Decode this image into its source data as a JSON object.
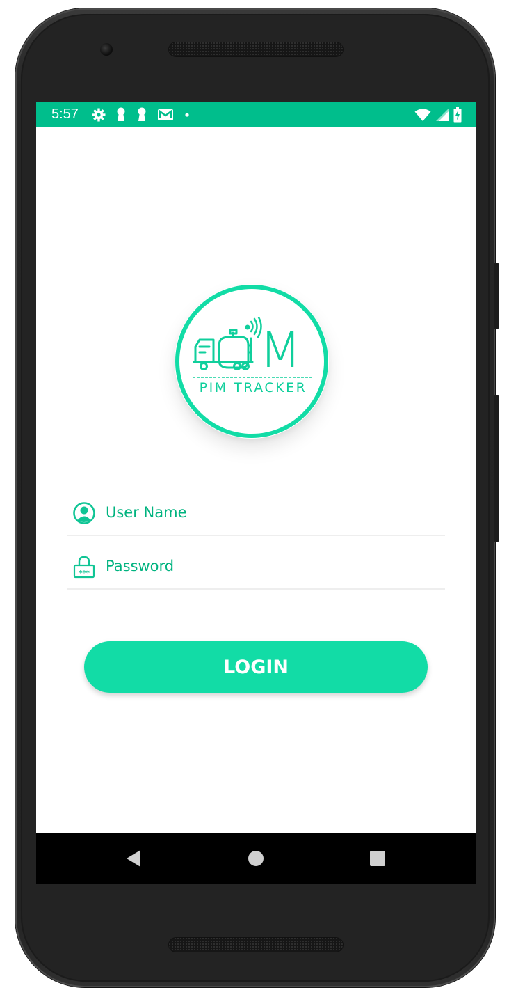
{
  "status_bar": {
    "time": "5:57",
    "background": "#00be8c",
    "left_icons": [
      "settings-icon",
      "keyhole-icon",
      "keyhole-icon",
      "gmail-icon",
      "dot-icon"
    ],
    "right_icons": [
      "wifi-icon",
      "cell-signal-icon",
      "battery-charging-icon"
    ]
  },
  "logo": {
    "letter": "M",
    "name": "PIM TRACKER",
    "color": "#10cf9c"
  },
  "form": {
    "username_placeholder": "User Name",
    "password_placeholder": "Password",
    "username_icon": "user-circle-icon",
    "password_icon": "lock-icon"
  },
  "login_button": {
    "label": "LOGIN",
    "color": "#12dca6"
  },
  "nav_bar": {
    "back": "back-icon",
    "home": "home-icon",
    "recents": "recents-icon"
  }
}
